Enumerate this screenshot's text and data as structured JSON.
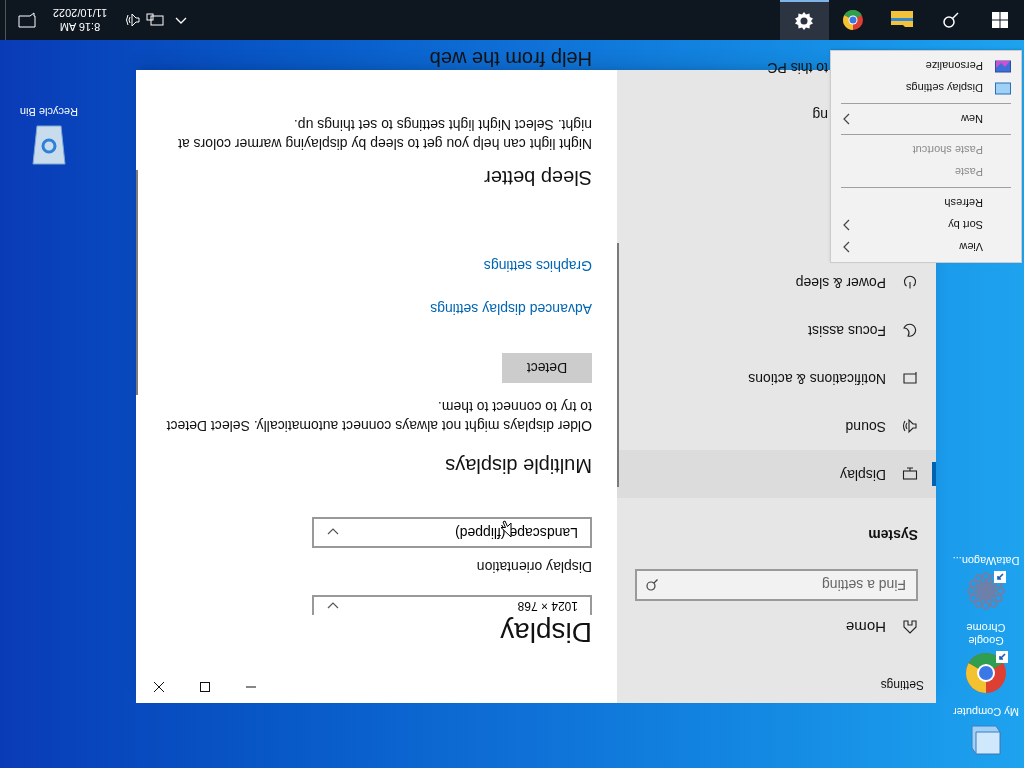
{
  "desktop_icons": [
    {
      "label": "My Computer",
      "kind": "computer",
      "shortcut": false
    },
    {
      "label": "Google Chrome",
      "kind": "chrome",
      "shortcut": true
    },
    {
      "label": "DataWagon...",
      "kind": "datawagon",
      "shortcut": true
    }
  ],
  "recycle_bin": {
    "label": "Recycle Bin"
  },
  "window": {
    "title": "Settings",
    "nav": {
      "home": "Home",
      "search": {
        "placeholder": "Find a setting"
      },
      "section": "System",
      "items": [
        {
          "label": "Display",
          "selected": true
        },
        {
          "label": "Sound",
          "selected": false
        },
        {
          "label": "Notifications & actions",
          "selected": false
        },
        {
          "label": "Focus assist",
          "selected": false
        },
        {
          "label": "Power & sleep",
          "selected": false
        }
      ],
      "covered_items": [
        {
          "label": "ng"
        },
        {
          "label": "to this PC"
        }
      ]
    },
    "content": {
      "title": "Display",
      "resolution": {
        "value": "1024 × 768"
      },
      "orientation_label": "Display orientation",
      "orientation": {
        "value": "Landscape (flipped)"
      },
      "multiple_heading": "Multiple displays",
      "multiple_text": "Older displays might not always connect automatically. Select Detect to try to connect to them.",
      "detect_button": "Detect",
      "links": [
        "Advanced display settings",
        "Graphics settings"
      ],
      "sleep_heading": "Sleep better",
      "sleep_text": "Night light can help you get to sleep by displaying warmer colors at night. Select Night light settings to set things up.",
      "help_heading": "Help from the web"
    }
  },
  "context_menu": [
    {
      "kind": "item",
      "label": "View",
      "submenu": true,
      "disabled": false
    },
    {
      "kind": "item",
      "label": "Sort by",
      "submenu": true,
      "disabled": false
    },
    {
      "kind": "item",
      "label": "Refresh",
      "submenu": false,
      "disabled": false
    },
    {
      "kind": "separator"
    },
    {
      "kind": "item",
      "label": "Paste",
      "submenu": false,
      "disabled": true
    },
    {
      "kind": "item",
      "label": "Paste shortcut",
      "submenu": false,
      "disabled": true
    },
    {
      "kind": "separator"
    },
    {
      "kind": "item",
      "label": "New",
      "submenu": true,
      "disabled": false
    },
    {
      "kind": "separator"
    },
    {
      "kind": "icon_item",
      "label": "Display settings",
      "submenu": false,
      "disabled": false
    },
    {
      "kind": "icon_item",
      "label": "Personalize",
      "submenu": false,
      "disabled": false
    }
  ],
  "taskbar": {
    "apps": [
      {
        "selected": false
      },
      {
        "selected": false
      },
      {
        "selected": false
      },
      {
        "selected": true
      }
    ],
    "time": "8:16 AM",
    "date": "11/10/2022"
  }
}
